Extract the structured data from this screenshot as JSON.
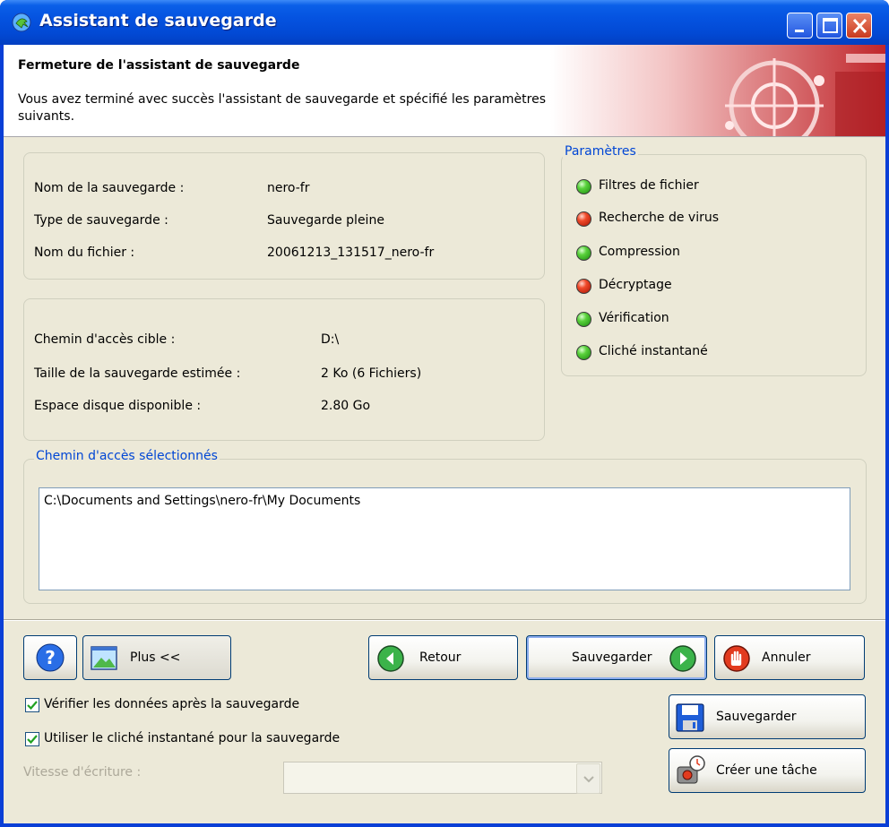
{
  "window": {
    "title": "Assistant de sauvegarde"
  },
  "header": {
    "title": "Fermeture de l'assistant de sauvegarde",
    "description": "Vous avez terminé avec succès l'assistant de sauvegarde et spécifié les paramètres suivants."
  },
  "summary": {
    "rows": [
      {
        "label": "Nom de la sauvegarde :",
        "value": "nero-fr"
      },
      {
        "label": "Type de sauvegarde :",
        "value": "Sauvegarde pleine"
      },
      {
        "label": "Nom du fichier :",
        "value": "20061213_131517_nero-fr"
      }
    ]
  },
  "target": {
    "rows": [
      {
        "label": "Chemin d'accès cible :",
        "value": "D:\\"
      },
      {
        "label": "Taille de la sauvegarde estimée :",
        "value": "2 Ko (6 Fichiers)"
      },
      {
        "label": "Espace disque disponible :",
        "value": "2.80 Go"
      }
    ]
  },
  "parameters": {
    "legend": "Paramètres",
    "items": [
      {
        "label": "Filtres de fichier",
        "status": "green"
      },
      {
        "label": "Recherche de virus",
        "status": "red"
      },
      {
        "label": "Compression",
        "status": "green"
      },
      {
        "label": "Décryptage",
        "status": "red"
      },
      {
        "label": "Vérification",
        "status": "green"
      },
      {
        "label": "Cliché instantané",
        "status": "green"
      }
    ],
    "colors": {
      "green": "#3fbf25",
      "red": "#e0331a"
    }
  },
  "selected_paths": {
    "legend": "Chemin d'accès sélectionnés",
    "items": [
      "C:\\Documents and Settings\\nero-fr\\My Documents"
    ]
  },
  "buttons": {
    "help_icon": "help-icon",
    "more_label": "Plus <<",
    "back_label": "Retour",
    "save_label": "Sauvegarder",
    "cancel_label": "Annuler",
    "save_settings_label": "Sauvegarder",
    "create_task_label": "Créer une tâche"
  },
  "options": {
    "verify": {
      "label": "Vérifier les données après la sauvegarde",
      "checked": true
    },
    "snapshot": {
      "label": "Utiliser le cliché instantané pour la sauvegarde",
      "checked": true
    },
    "write_speed": {
      "label": "Vitesse d'écriture :",
      "value": ""
    }
  }
}
